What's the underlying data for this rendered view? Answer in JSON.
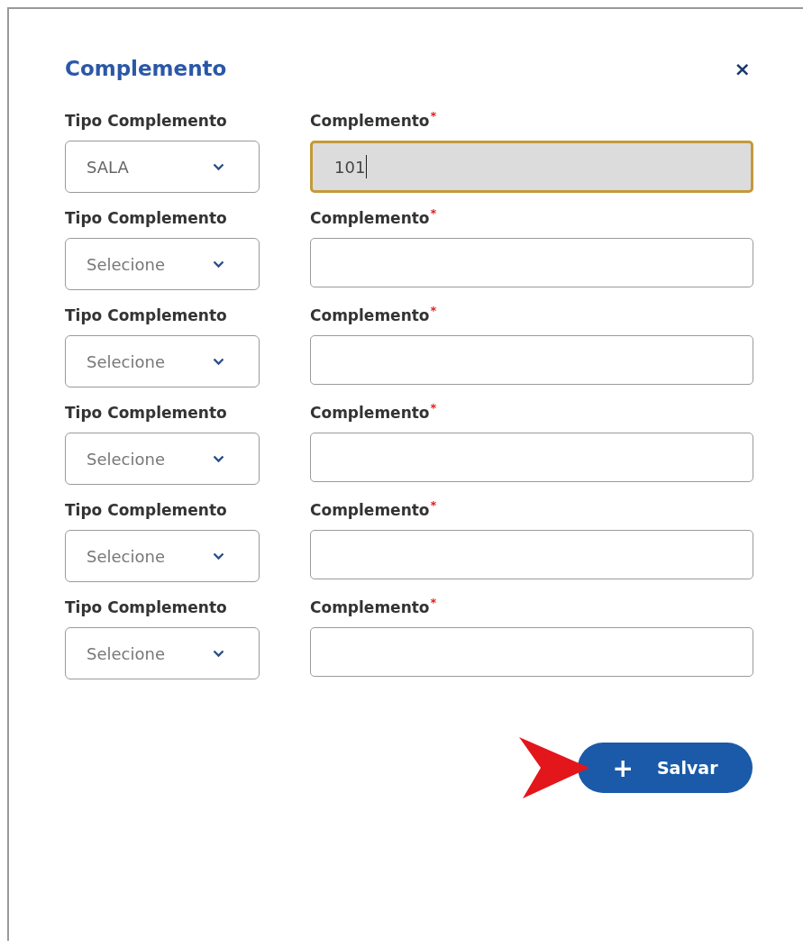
{
  "dialog": {
    "title": "Complemento",
    "close": "×"
  },
  "rows": [
    {
      "type_field": {
        "label": "Tipo Complemento",
        "value": "SALA"
      },
      "complement_field": {
        "label": "Complemento",
        "required_mark": "*",
        "value": "101",
        "focused": true
      }
    },
    {
      "type_field": {
        "label": "Tipo Complemento",
        "placeholder": "Selecione"
      },
      "complement_field": {
        "label": "Complemento",
        "required_mark": "*",
        "focused": false
      }
    },
    {
      "type_field": {
        "label": "Tipo Complemento",
        "placeholder": "Selecione"
      },
      "complement_field": {
        "label": "Complemento",
        "required_mark": "*",
        "focused": false
      }
    },
    {
      "type_field": {
        "label": "Tipo Complemento",
        "placeholder": "Selecione"
      },
      "complement_field": {
        "label": "Complemento",
        "required_mark": "*",
        "focused": false
      }
    },
    {
      "type_field": {
        "label": "Tipo Complemento",
        "placeholder": "Selecione"
      },
      "complement_field": {
        "label": "Complemento",
        "required_mark": "*",
        "focused": false
      }
    },
    {
      "type_field": {
        "label": "Tipo Complemento",
        "placeholder": "Selecione"
      },
      "complement_field": {
        "label": "Complemento",
        "required_mark": "*",
        "focused": false
      }
    }
  ],
  "save_button": {
    "icon": "+",
    "label": "Salvar"
  }
}
